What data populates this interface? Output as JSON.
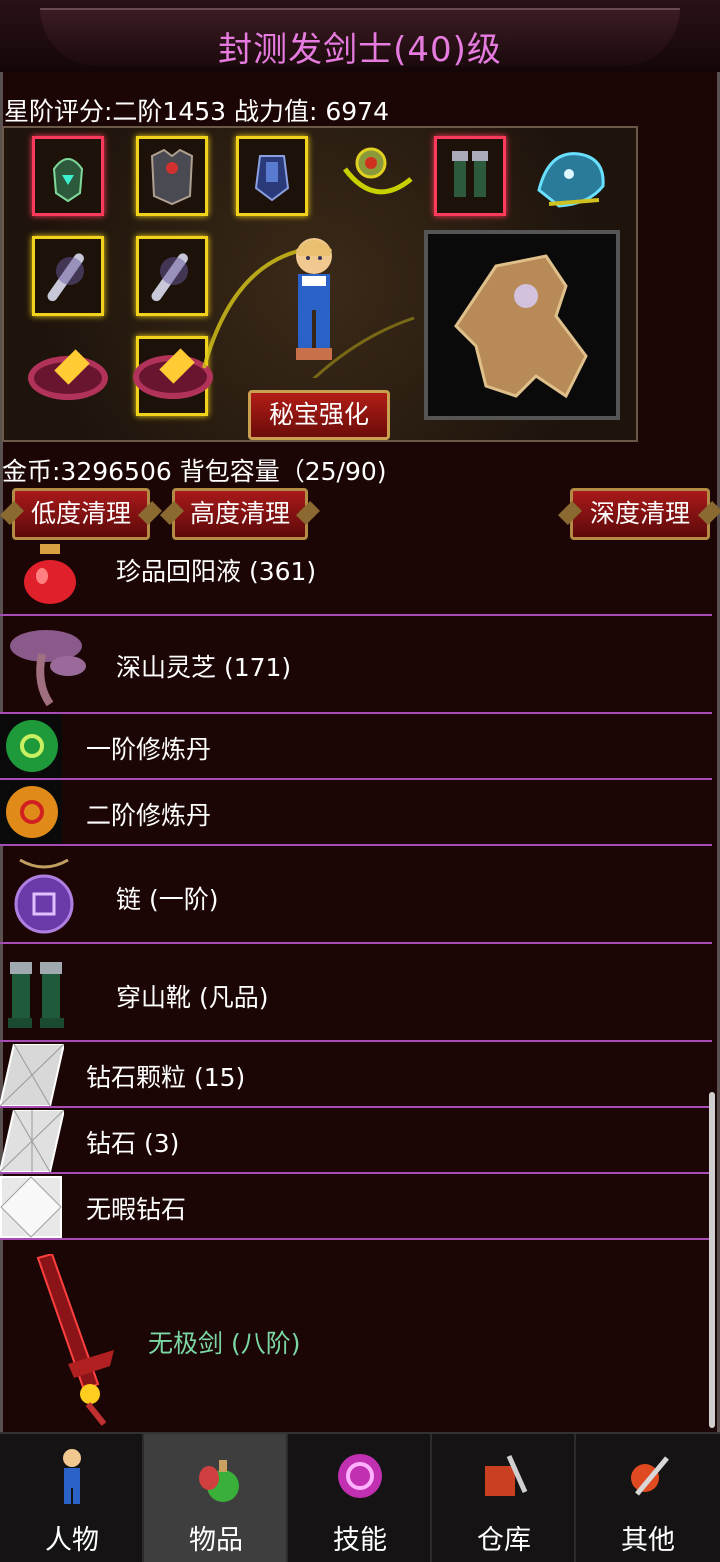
{
  "header": {
    "title": "封测发剑士(40)级"
  },
  "stats": {
    "rating_line": "星阶评分:二阶1453 战力值:  6974"
  },
  "equipment": {
    "slots": [
      {
        "name": "helmet",
        "frame": "red"
      },
      {
        "name": "armor",
        "frame": "gold"
      },
      {
        "name": "gauntlet",
        "frame": "gold"
      },
      {
        "name": "necklace",
        "frame": "none"
      },
      {
        "name": "greaves",
        "frame": "red"
      },
      {
        "name": "pet-beast",
        "frame": "none"
      },
      {
        "name": "sword-left",
        "frame": "gold"
      },
      {
        "name": "sword-right",
        "frame": "gold"
      },
      {
        "name": "ring-left",
        "frame": "none"
      },
      {
        "name": "ring-right",
        "frame": "gold"
      }
    ],
    "treasure_button": "秘宝强化"
  },
  "inventory_info": {
    "gold_line": "金币:3296506 背包容量（25/90)"
  },
  "buttons": {
    "low_clean": "低度清理",
    "high_clean": "高度清理",
    "deep_clean": "深度清理"
  },
  "items": [
    {
      "name": "珍品回阳液 (361)",
      "icon": "red-potion-icon"
    },
    {
      "name": "深山灵芝 (171)",
      "icon": "mushroom-icon"
    },
    {
      "name": "一阶修炼丹",
      "icon": "green-pill-icon"
    },
    {
      "name": "二阶修炼丹",
      "icon": "orange-pill-icon"
    },
    {
      "name": "链 (一阶)",
      "icon": "purple-chain-icon"
    },
    {
      "name": "穿山靴 (凡品)",
      "icon": "boots-icon"
    },
    {
      "name": "钻石颗粒 (15)",
      "icon": "diamond-particle-icon"
    },
    {
      "name": "钻石 (3)",
      "icon": "diamond-icon"
    },
    {
      "name": "无暇钻石",
      "icon": "flawless-diamond-icon"
    },
    {
      "name": "无极剑 (八阶)",
      "icon": "red-sword-icon"
    }
  ],
  "tabs": [
    {
      "label": "人物",
      "icon": "character-icon"
    },
    {
      "label": "物品",
      "icon": "items-icon"
    },
    {
      "label": "技能",
      "icon": "skills-icon"
    },
    {
      "label": "仓库",
      "icon": "warehouse-icon"
    },
    {
      "label": "其他",
      "icon": "other-icon"
    }
  ],
  "colors": {
    "title": "#e67be0",
    "divider": "#a64cb4",
    "rare_item": "#7ad7a4",
    "active_tab": "#3e3e3e"
  }
}
